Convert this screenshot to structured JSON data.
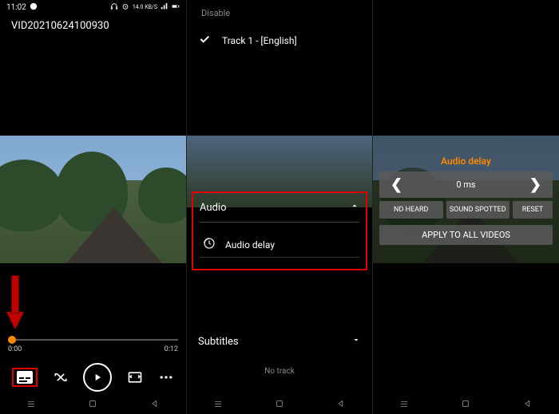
{
  "statusbar": {
    "time": "11:02",
    "net_label": "14.0 KB/S",
    "battery": "battery"
  },
  "video": {
    "title": "VID20210624100930",
    "current_time": "0:00",
    "duration": "0:12"
  },
  "audio_menu": {
    "header": "Audio",
    "delay_item": "Audio delay",
    "disable": "Disable",
    "track": "Track 1 - [English]"
  },
  "subtitles_menu": {
    "header": "Subtitles",
    "no_track": "No track"
  },
  "delay_panel": {
    "title": "Audio delay",
    "value": "0 ms",
    "sound_heard": "ND HEARD",
    "sound_spotted": "SOUND SPOTTED",
    "reset": "RESET",
    "apply_all": "APPLY TO ALL VIDEOS"
  },
  "colors": {
    "accent": "#ff8800",
    "highlight": "#e00000"
  }
}
